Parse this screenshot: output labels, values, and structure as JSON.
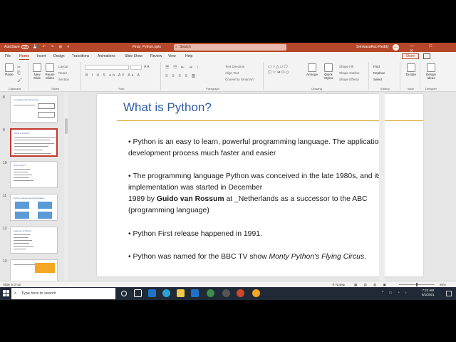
{
  "titlebar": {
    "autosave": "AutoSave",
    "toggle": "Off",
    "qat": "💾 ↶ ↷ ⊞ ▾",
    "document_name": "Final_Python.pptx",
    "search_placeholder": "Search",
    "user_name": "SrinivasaRao Reddy",
    "avatar_initials": "SR",
    "window_controls": "— □ ✕"
  },
  "tabs": {
    "items": [
      "File",
      "Home",
      "Insert",
      "Design",
      "Transitions",
      "Animations",
      "Slide Show",
      "Review",
      "View",
      "Help"
    ],
    "active": "Home",
    "share_label": "Share"
  },
  "ribbon": {
    "clipboard": {
      "paste": "Paste",
      "label": "Clipboard"
    },
    "slides": {
      "new_slide": "New Slide",
      "reuse_slides": "Reuse Slides",
      "layout": "Layout",
      "reset": "Reset",
      "section": "Section",
      "label": "Slides"
    },
    "font": {
      "label": "Font",
      "format_buttons": "B I U S ab AV Aa A"
    },
    "paragraph": {
      "text_direction": "Text Direction",
      "align_text": "Align Text",
      "smartart": "Convert to SmartArt",
      "label": "Paragraph"
    },
    "drawing": {
      "shapes": "▭○△▱⬠\n⬡☆➔⬭◇",
      "arrange": "Arrange",
      "quick_styles": "Quick Styles",
      "shape_fill": "Shape Fill",
      "shape_outline": "Shape Outline",
      "shape_effects": "Shape Effects",
      "label": "Drawing"
    },
    "editing": {
      "find": "Find",
      "replace": "Replace",
      "select": "Select",
      "label": "Editing"
    },
    "voice": {
      "dictate": "Dictate",
      "label": "Voice"
    },
    "designer": {
      "design_ideas": "Design Ideas",
      "label": "Designer"
    }
  },
  "thumbnails": [
    {
      "num": "8",
      "title": "Compiling and Interpreting"
    },
    {
      "num": "9",
      "title": "What is Python?"
    },
    {
      "num": "10",
      "title": "Why Python?"
    },
    {
      "num": "11",
      "title": "Python features and Advantages"
    },
    {
      "num": "12",
      "title": "Features of Python"
    },
    {
      "num": "13",
      "title": ""
    }
  ],
  "slide": {
    "title": "What is Python?",
    "bullets": [
      "• Python is an easy to learn, powerful programming language. The application development process much faster and easier",
      "• The programming language Python was conceived in the late 1980s, and its implementation was started in December",
      "• Python First release happened in 1991.",
      "• Python was named for the BBC TV show "
    ],
    "bullet2_line3_pre": "1989 by ",
    "bullet2_bold": "Guido van Rossum",
    "bullet2_line3_post": " at  _Netherlands as a successor to the ABC (programming language)",
    "bullet4_italic": "Monty Python's Flying Circus",
    "bullet4_end": "."
  },
  "statusbar": {
    "slide_count": "Slide 9 of 42",
    "notes": "≜ Notes",
    "comments": "▭",
    "views": "▦ ▤ ▥ ▣",
    "zoom": "86%"
  },
  "taskbar": {
    "search_placeholder": "Type here to search",
    "tray": "^ ▭ ◔ ♪",
    "time": "7:23 AM",
    "date": "5/1/2021"
  }
}
